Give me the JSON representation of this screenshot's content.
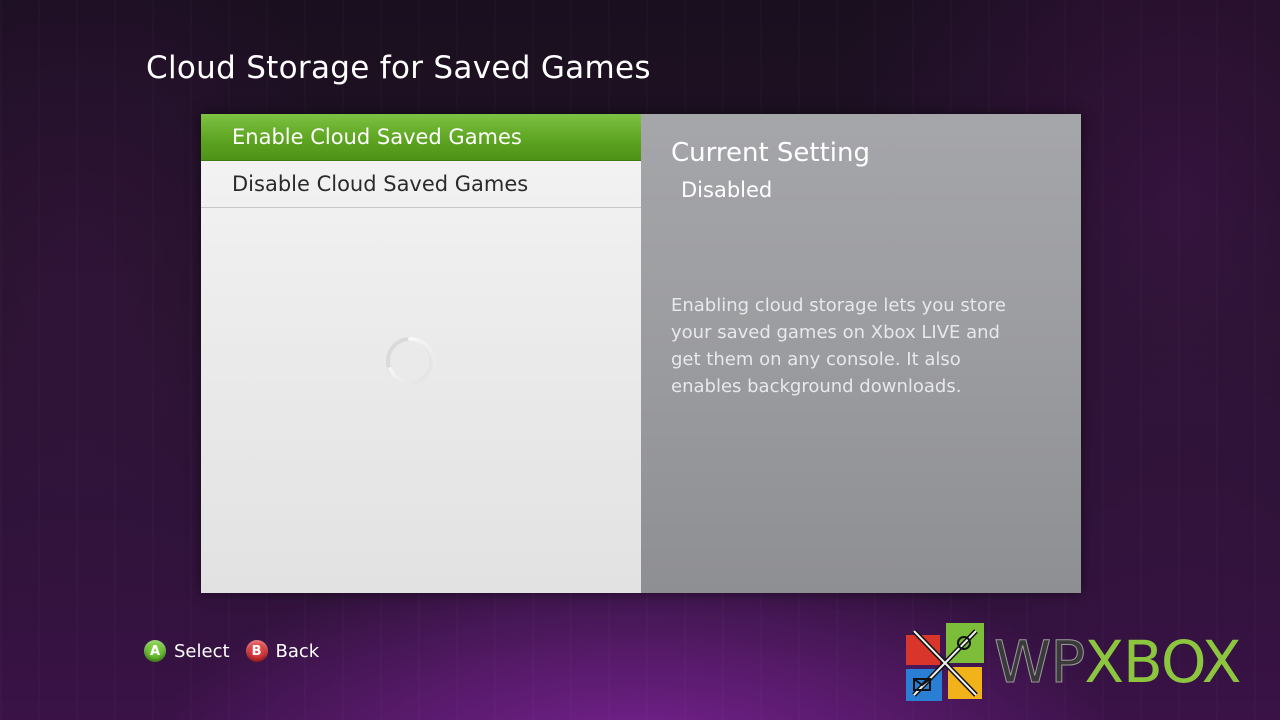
{
  "screen": {
    "title": "Cloud Storage for Saved Games"
  },
  "menu": {
    "items": [
      {
        "label": "Enable Cloud Saved Games",
        "selected": true
      },
      {
        "label": "Disable Cloud Saved Games",
        "selected": false
      }
    ],
    "loading_indicator": "spinner-icon"
  },
  "info": {
    "current_setting_label": "Current Setting",
    "current_setting_value": "Disabled",
    "description_lines": [
      "Enabling cloud storage lets you store",
      "your saved games on Xbox LIVE and",
      "get them on any console. It also",
      "enables background downloads."
    ]
  },
  "footer": {
    "a_button": {
      "glyph": "A",
      "label": "Select",
      "color": "#5fb22a"
    },
    "b_button": {
      "glyph": "B",
      "label": "Back",
      "color": "#d42a2a"
    }
  },
  "watermark": {
    "text_part1": "WP",
    "text_part2": "XBOX",
    "accent_color": "#8cc63f"
  },
  "colors": {
    "selected_item": "#5ea522",
    "right_pane": "#9c9da0",
    "left_pane": "#ececec"
  }
}
